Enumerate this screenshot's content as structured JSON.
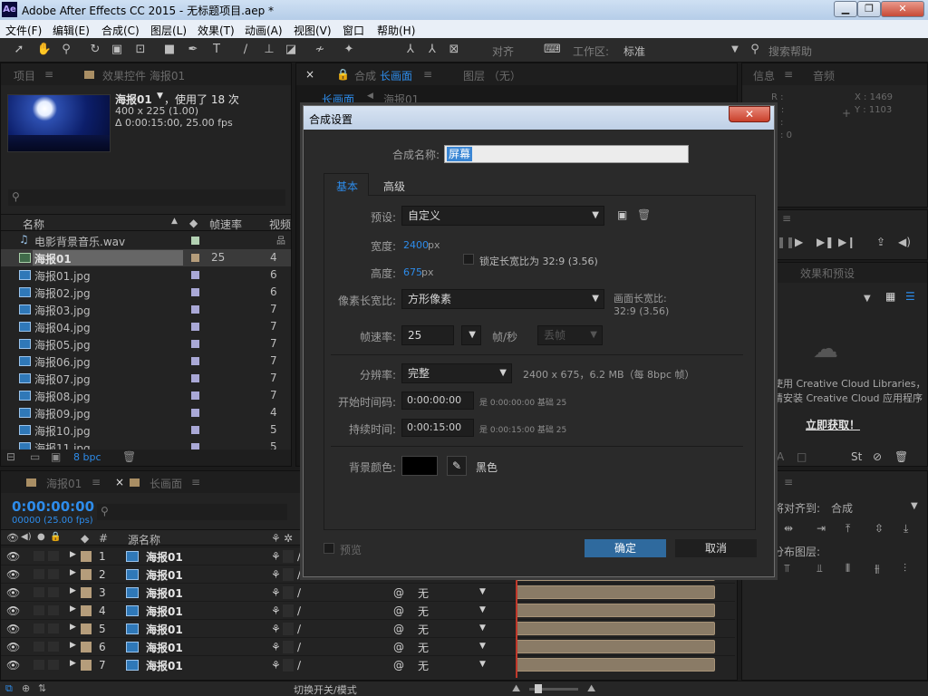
{
  "window": {
    "title": "Adobe After Effects CC 2015 - 无标题项目.aep *",
    "logo": "Ae",
    "min": "▁",
    "max": "❐",
    "close": "✕"
  },
  "menu": [
    "文件(F)",
    "编辑(E)",
    "合成(C)",
    "图层(L)",
    "效果(T)",
    "动画(A)",
    "视图(V)",
    "窗口",
    "帮助(H)"
  ],
  "toolbar": {
    "align_label": "对齐",
    "workspace_label": "工作区:",
    "workspace_value": "标准",
    "search_help": "搜索帮助"
  },
  "project_panel": {
    "tab_project": "项目",
    "tab_effects": "效果控件 海报01",
    "item_name": "海报01",
    "item_usage": "，使用了 18 次",
    "item_dims": "400 x 225 (1.00)",
    "item_duration": "Δ 0:00:15:00, 25.00 fps",
    "col_name": "名称",
    "col_fps": "帧速率",
    "col_video": "视频",
    "files": [
      {
        "name": "电影背景音乐.wav",
        "fps": "",
        "val": ""
      },
      {
        "name": "海报01",
        "fps": "25",
        "val": "4"
      },
      {
        "name": "海报01.jpg",
        "fps": "",
        "val": "6"
      },
      {
        "name": "海报02.jpg",
        "fps": "",
        "val": "6"
      },
      {
        "name": "海报03.jpg",
        "fps": "",
        "val": "7"
      },
      {
        "name": "海报04.jpg",
        "fps": "",
        "val": "7"
      },
      {
        "name": "海报05.jpg",
        "fps": "",
        "val": "7"
      },
      {
        "name": "海报06.jpg",
        "fps": "",
        "val": "7"
      },
      {
        "name": "海报07.jpg",
        "fps": "",
        "val": "7"
      },
      {
        "name": "海报08.jpg",
        "fps": "",
        "val": "7"
      },
      {
        "name": "海报09.jpg",
        "fps": "",
        "val": "4"
      },
      {
        "name": "海报10.jpg",
        "fps": "",
        "val": "5"
      },
      {
        "name": "海报11.jpg",
        "fps": "",
        "val": "5"
      }
    ],
    "bpc": "8 bpc"
  },
  "comp_panel": {
    "tab_comp": "合成",
    "tab_comp_name": "长画面",
    "tab_layer": "图层 （无）",
    "crumb_1": "长画面",
    "crumb_2": "海报01"
  },
  "info_panel": {
    "tab_info": "信息",
    "tab_audio": "音频",
    "r": "R :",
    "g": "G :",
    "b": "B :",
    "a": "A : 0",
    "x": "X : 1469",
    "y": "Y : 1103"
  },
  "effects_panel": {
    "tab": "效果和预设",
    "cc_line1": "使用 Creative Cloud Libraries，",
    "cc_line2": "请安装 Creative Cloud 应用程序",
    "cc_link": "立即获取！"
  },
  "align_panel": {
    "align_to_label": "将对齐到:",
    "align_to_value": "合成",
    "distribute_label": "分布图层:"
  },
  "timeline": {
    "tab_1": "海报01",
    "tab_2": "长画面",
    "timecode": "0:00:00:00",
    "frame": "00000 (25.00 fps)",
    "col_num": "#",
    "col_source": "源名称",
    "parent_value": "无",
    "layers": [
      {
        "num": "1",
        "name": "海报01"
      },
      {
        "num": "2",
        "name": "海报01"
      },
      {
        "num": "3",
        "name": "海报01"
      },
      {
        "num": "4",
        "name": "海报01"
      },
      {
        "num": "5",
        "name": "海报01"
      },
      {
        "num": "6",
        "name": "海报01"
      },
      {
        "num": "7",
        "name": "海报01"
      }
    ],
    "bottom_toggle": "切换开关/模式"
  },
  "dialog": {
    "title": "合成设置",
    "close": "✕",
    "comp_name_label": "合成名称:",
    "comp_name_value": "屏幕",
    "tab_basic": "基本",
    "tab_advanced": "高级",
    "preset_label": "预设:",
    "preset_value": "自定义",
    "width_label": "宽度:",
    "width_value": "2400",
    "height_label": "高度:",
    "height_value": "675",
    "px": "px",
    "lock_ratio": "锁定长宽比为 32:9 (3.56)",
    "pixel_ratio_label": "像素长宽比:",
    "pixel_ratio_value": "方形像素",
    "frame_ratio_label": "画面长宽比:",
    "frame_ratio_value": "32:9 (3.56)",
    "fps_label": "帧速率:",
    "fps_value": "25",
    "fps_unit": "帧/秒",
    "drop_frame": "丢帧",
    "res_label": "分辨率:",
    "res_value": "完整",
    "res_info": "2400 x 675，6.2 MB（每 8bpc 帧）",
    "start_tc_label": "开始时间码:",
    "start_tc_value": "0:00:00:00",
    "start_tc_info": "是 0:00:00:00  基础 25",
    "duration_label": "持续时间:",
    "duration_value": "0:00:15:00",
    "duration_info": "是 0:00:15:00  基础 25",
    "bg_label": "背景颜色:",
    "bg_name": "黑色",
    "preview": "预览",
    "ok": "确定",
    "cancel": "取消"
  },
  "colors": {
    "accent": "#2d8ceb",
    "ok_button": "#2f6a9e",
    "label_tan": "#b59d7b"
  }
}
